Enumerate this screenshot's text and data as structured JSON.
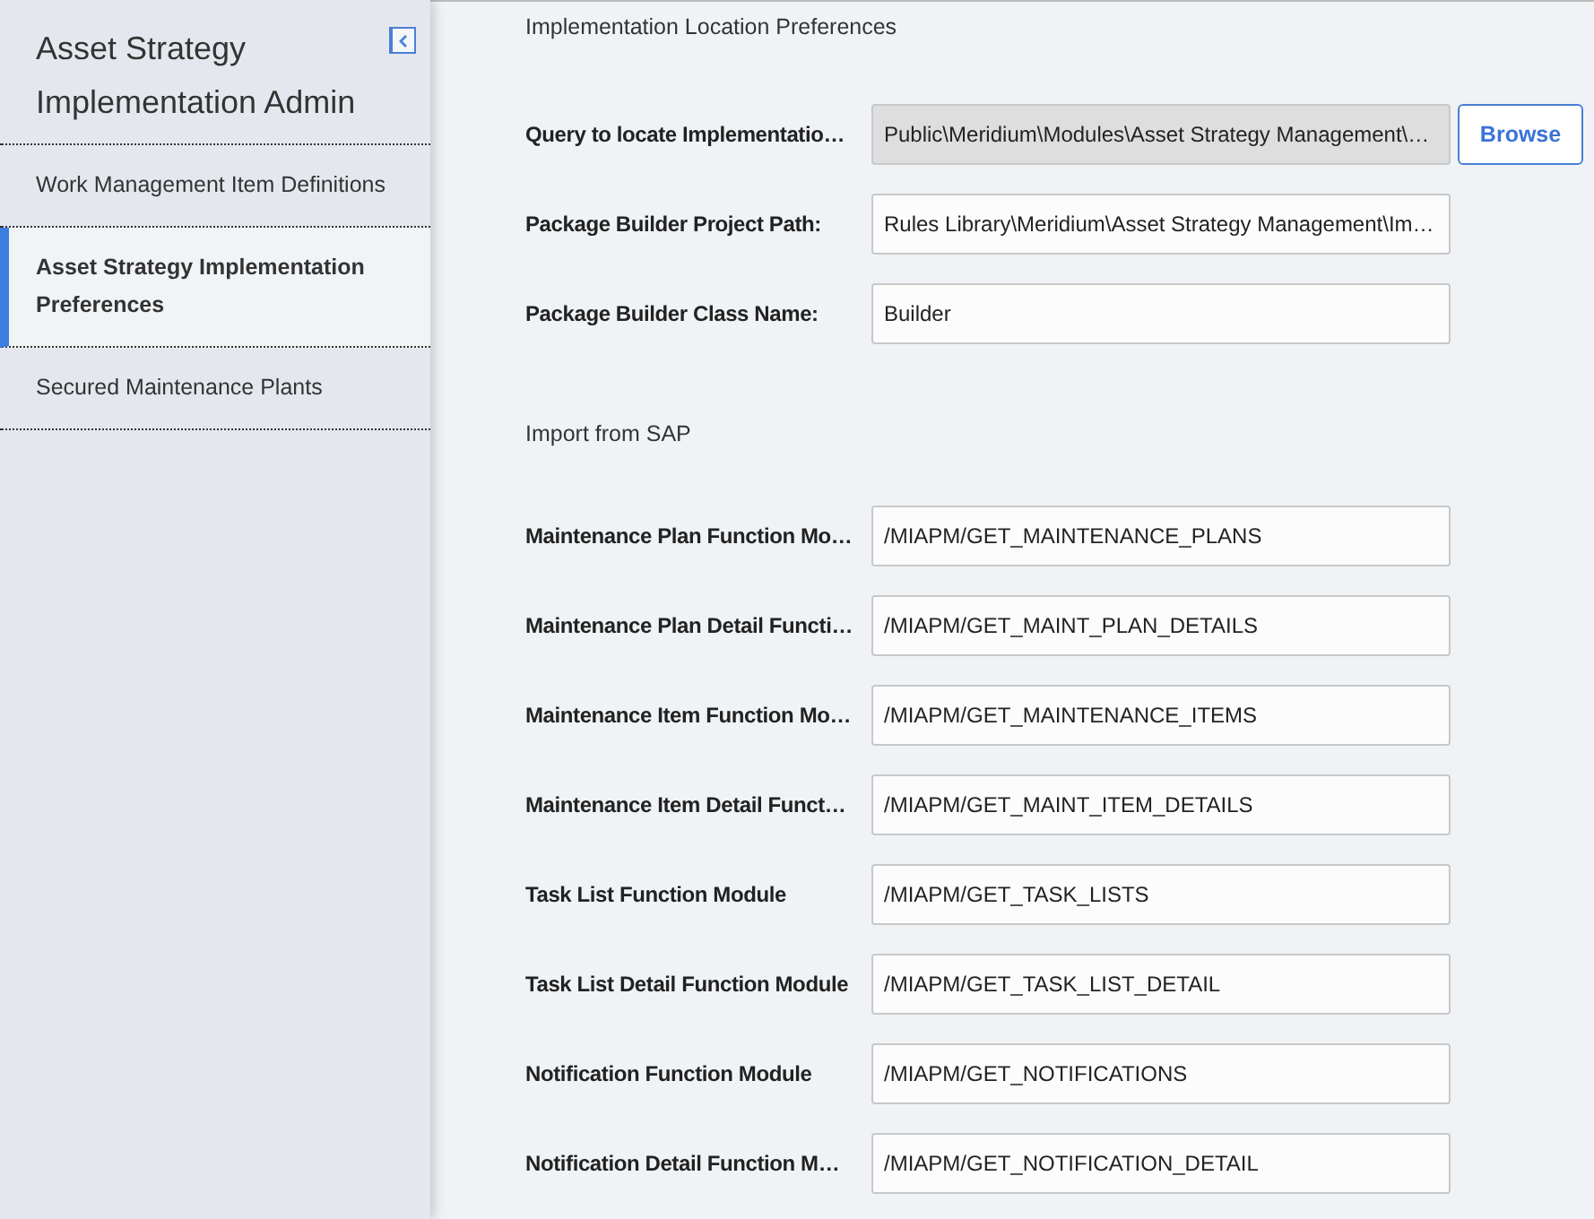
{
  "sidebar": {
    "title": "Asset Strategy Implementation Admin",
    "items": [
      {
        "label": "Work Management Item Definitions",
        "selected": false
      },
      {
        "label": "Asset Strategy Implementation Preferences",
        "selected": true
      },
      {
        "label": "Secured Maintenance Plants",
        "selected": false
      }
    ]
  },
  "sections": [
    {
      "heading": "Implementation Location Preferences",
      "fields": [
        {
          "label": "Query to locate Implementatio…",
          "value": "Public\\Meridium\\Modules\\Asset Strategy Management\\…",
          "disabled": true,
          "button": "Browse"
        },
        {
          "label": "Package Builder Project Path:",
          "value": "Rules Library\\Meridium\\Asset Strategy Management\\Im…",
          "disabled": false
        },
        {
          "label": "Package Builder Class Name:",
          "value": "Builder",
          "disabled": false
        }
      ]
    },
    {
      "heading": "Import from SAP",
      "fields": [
        {
          "label": "Maintenance Plan Function Mo…",
          "value": "/MIAPM/GET_MAINTENANCE_PLANS",
          "disabled": false
        },
        {
          "label": "Maintenance Plan Detail Functi…",
          "value": "/MIAPM/GET_MAINT_PLAN_DETAILS",
          "disabled": false
        },
        {
          "label": "Maintenance Item Function Mo…",
          "value": "/MIAPM/GET_MAINTENANCE_ITEMS",
          "disabled": false
        },
        {
          "label": "Maintenance Item Detail Funct…",
          "value": "/MIAPM/GET_MAINT_ITEM_DETAILS",
          "disabled": false
        },
        {
          "label": "Task List Function Module",
          "value": "/MIAPM/GET_TASK_LISTS",
          "disabled": false
        },
        {
          "label": "Task List Detail Function Module",
          "value": "/MIAPM/GET_TASK_LIST_DETAIL",
          "disabled": false
        },
        {
          "label": "Notification Function Module",
          "value": "/MIAPM/GET_NOTIFICATIONS",
          "disabled": false
        },
        {
          "label": "Notification Detail Function M…",
          "value": "/MIAPM/GET_NOTIFICATION_DETAIL",
          "disabled": false
        }
      ]
    }
  ]
}
